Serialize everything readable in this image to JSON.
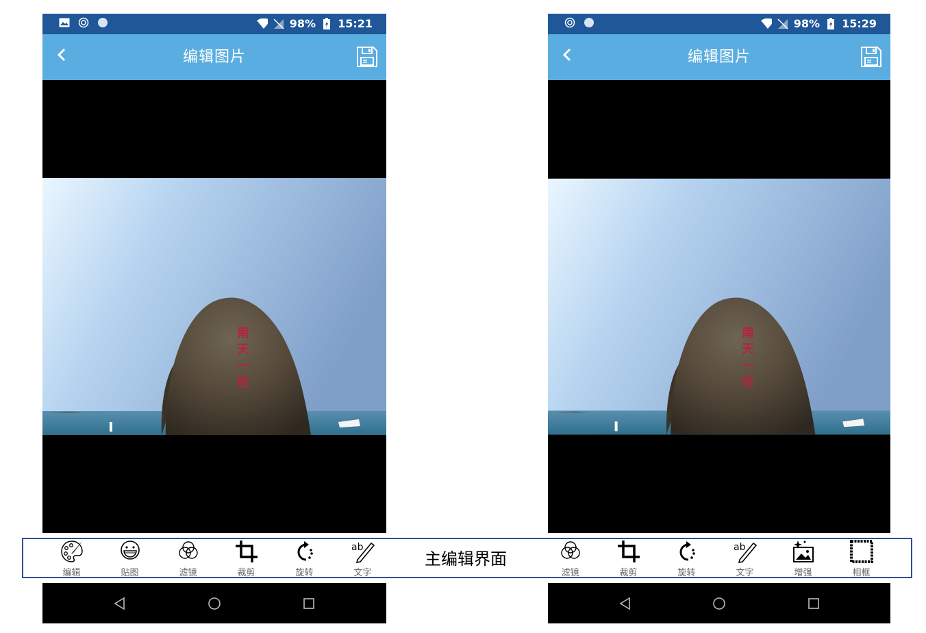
{
  "left": {
    "status": {
      "battery": "98%",
      "time": "15:21"
    },
    "title": "编辑图片",
    "tools": [
      {
        "icon": "palette-icon",
        "label": "编辑"
      },
      {
        "icon": "sticker-icon",
        "label": "贴图"
      },
      {
        "icon": "filter-icon",
        "label": "滤镜"
      },
      {
        "icon": "crop-icon",
        "label": "裁剪"
      },
      {
        "icon": "rotate-icon",
        "label": "旋转"
      },
      {
        "icon": "text-icon",
        "label": "文字"
      }
    ]
  },
  "right": {
    "status": {
      "battery": "98%",
      "time": "15:29"
    },
    "title": "编辑图片",
    "tools": [
      {
        "icon": "filter-icon",
        "label": "滤镜"
      },
      {
        "icon": "crop-icon",
        "label": "裁剪"
      },
      {
        "icon": "rotate-icon",
        "label": "旋转"
      },
      {
        "icon": "text-icon",
        "label": "文字"
      },
      {
        "icon": "enhance-icon",
        "label": "增强"
      },
      {
        "icon": "frame-icon",
        "label": "相框"
      }
    ]
  },
  "caption": "主编辑界面",
  "colors": {
    "statusbar": "#1f5799",
    "appbar": "#5aade0",
    "frame": "#2f4f8f"
  }
}
